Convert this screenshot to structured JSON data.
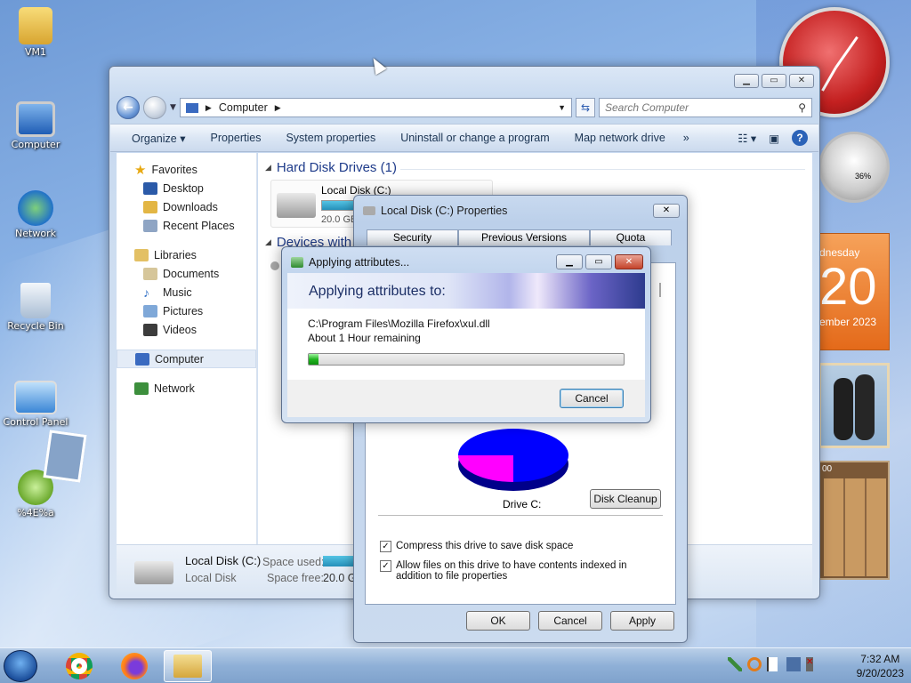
{
  "desktop": {
    "icons": [
      {
        "label": "VM1"
      },
      {
        "label": "Computer"
      },
      {
        "label": "Network"
      },
      {
        "label": "Recycle Bin"
      },
      {
        "label": "Control Panel"
      },
      {
        "label": "%4E%a"
      }
    ]
  },
  "explorer": {
    "address": "Computer",
    "search_placeholder": "Search Computer",
    "toolbar": [
      "Organize",
      "Properties",
      "System properties",
      "Uninstall or change a program",
      "Map network drive"
    ],
    "toolbar_more": "»",
    "nav": {
      "favorites": "Favorites",
      "favorites_items": [
        "Desktop",
        "Downloads",
        "Recent Places"
      ],
      "libraries": "Libraries",
      "libraries_items": [
        "Documents",
        "Music",
        "Pictures",
        "Videos"
      ],
      "computer": "Computer",
      "network": "Network"
    },
    "groups": {
      "hdd": "Hard Disk Drives (1)",
      "devices": "Devices with"
    },
    "drive": {
      "name": "Local Disk (C:)",
      "size": "20.0 GB",
      "used_fraction": 0.75
    },
    "details": {
      "name": "Local Disk (C:)",
      "type": "Local Disk",
      "space_used_label": "Space used:",
      "space_free_label": "Space free:",
      "space_free": "20.0 GB"
    }
  },
  "properties_dialog": {
    "title": "Local Disk (C:) Properties",
    "tabs": [
      "Security",
      "Previous Versions",
      "Quota"
    ],
    "drive_label": "Drive C:",
    "disk_cleanup": "Disk Cleanup",
    "compress_label": "Compress this drive to save disk space",
    "index_label": "Allow files on this drive to have contents indexed in addition to file properties",
    "ok": "OK",
    "cancel": "Cancel",
    "apply": "Apply",
    "pie_colors": {
      "used": "#0000ff",
      "free": "#ff00ff"
    }
  },
  "apply_dialog": {
    "title": "Applying attributes...",
    "heading": "Applying attributes to:",
    "file": "C:\\Program Files\\Mozilla Firefox\\xul.dll",
    "remaining": "About 1 Hour remaining",
    "progress": 0.03,
    "cancel": "Cancel"
  },
  "gadgets": {
    "meter_percent": "36%",
    "calendar_day": "dnesday",
    "calendar_date": "20",
    "calendar_month": "ember 2023",
    "puzzle_time": "00"
  },
  "taskbar": {
    "time": "7:32 AM",
    "date": "9/20/2023"
  }
}
